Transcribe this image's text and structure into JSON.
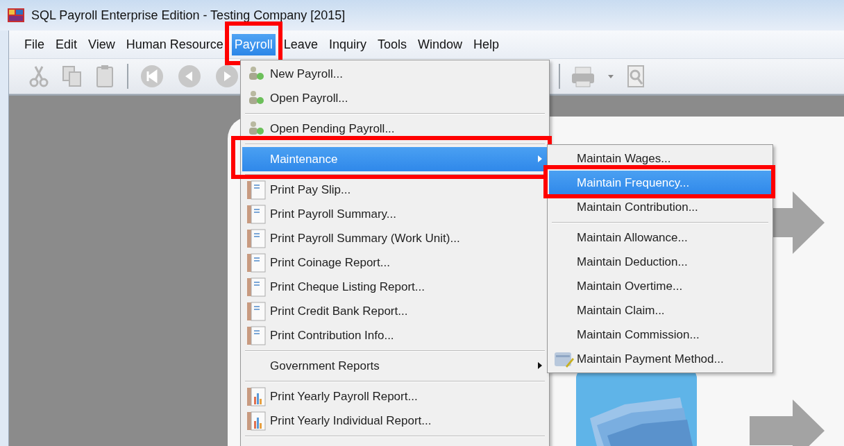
{
  "window": {
    "title": "SQL Payroll Enterprise Edition - Testing Company [2015]"
  },
  "menu_bar": [
    {
      "label": "File",
      "selected": false
    },
    {
      "label": "Edit",
      "selected": false
    },
    {
      "label": "View",
      "selected": false
    },
    {
      "label": "Human Resource",
      "selected": false
    },
    {
      "label": "Payroll",
      "selected": true
    },
    {
      "label": "Leave",
      "selected": false
    },
    {
      "label": "Inquiry",
      "selected": false
    },
    {
      "label": "Tools",
      "selected": false
    },
    {
      "label": "Window",
      "selected": false
    },
    {
      "label": "Help",
      "selected": false
    }
  ],
  "payroll_menu": {
    "items": [
      {
        "kind": "people",
        "label": "New Payroll...",
        "selected": false
      },
      {
        "kind": "people",
        "label": "Open Payroll...",
        "selected": false
      },
      {
        "kind": "separator"
      },
      {
        "kind": "people",
        "label": "Open Pending Payroll...",
        "selected": false
      },
      {
        "kind": "separator"
      },
      {
        "kind": "submenu",
        "label": "Maintenance",
        "selected": true
      },
      {
        "kind": "separator"
      },
      {
        "kind": "report",
        "label": "Print Pay Slip...",
        "selected": false
      },
      {
        "kind": "report",
        "label": "Print Payroll Summary...",
        "selected": false
      },
      {
        "kind": "report",
        "label": "Print Payroll Summary (Work Unit)...",
        "selected": false
      },
      {
        "kind": "report",
        "label": "Print Coinage Report...",
        "selected": false
      },
      {
        "kind": "report",
        "label": "Print Cheque Listing Report...",
        "selected": false
      },
      {
        "kind": "report",
        "label": "Print Credit Bank Report...",
        "selected": false
      },
      {
        "kind": "report",
        "label": "Print Contribution Info...",
        "selected": false
      },
      {
        "kind": "separator"
      },
      {
        "kind": "submenu",
        "label": "Government Reports",
        "selected": false
      },
      {
        "kind": "separator"
      },
      {
        "kind": "chart",
        "label": "Print Yearly Payroll Report...",
        "selected": false
      },
      {
        "kind": "chart",
        "label": "Print Yearly Individual Report...",
        "selected": false
      },
      {
        "kind": "separator"
      }
    ]
  },
  "maintenance_submenu": {
    "items": [
      {
        "kind": "plain",
        "label": "Maintain Wages...",
        "selected": false
      },
      {
        "kind": "plain",
        "label": "Maintain Frequency...",
        "selected": true
      },
      {
        "kind": "plain",
        "label": "Maintain Contribution...",
        "selected": false
      },
      {
        "kind": "separator"
      },
      {
        "kind": "plain",
        "label": "Maintain Allowance...",
        "selected": false
      },
      {
        "kind": "plain",
        "label": "Maintain Deduction...",
        "selected": false
      },
      {
        "kind": "plain",
        "label": "Maintain Overtime...",
        "selected": false
      },
      {
        "kind": "plain",
        "label": "Maintain Claim...",
        "selected": false
      },
      {
        "kind": "plain",
        "label": "Maintain Commission...",
        "selected": false
      },
      {
        "kind": "cards",
        "label": "Maintain Payment Method...",
        "selected": false
      }
    ]
  }
}
